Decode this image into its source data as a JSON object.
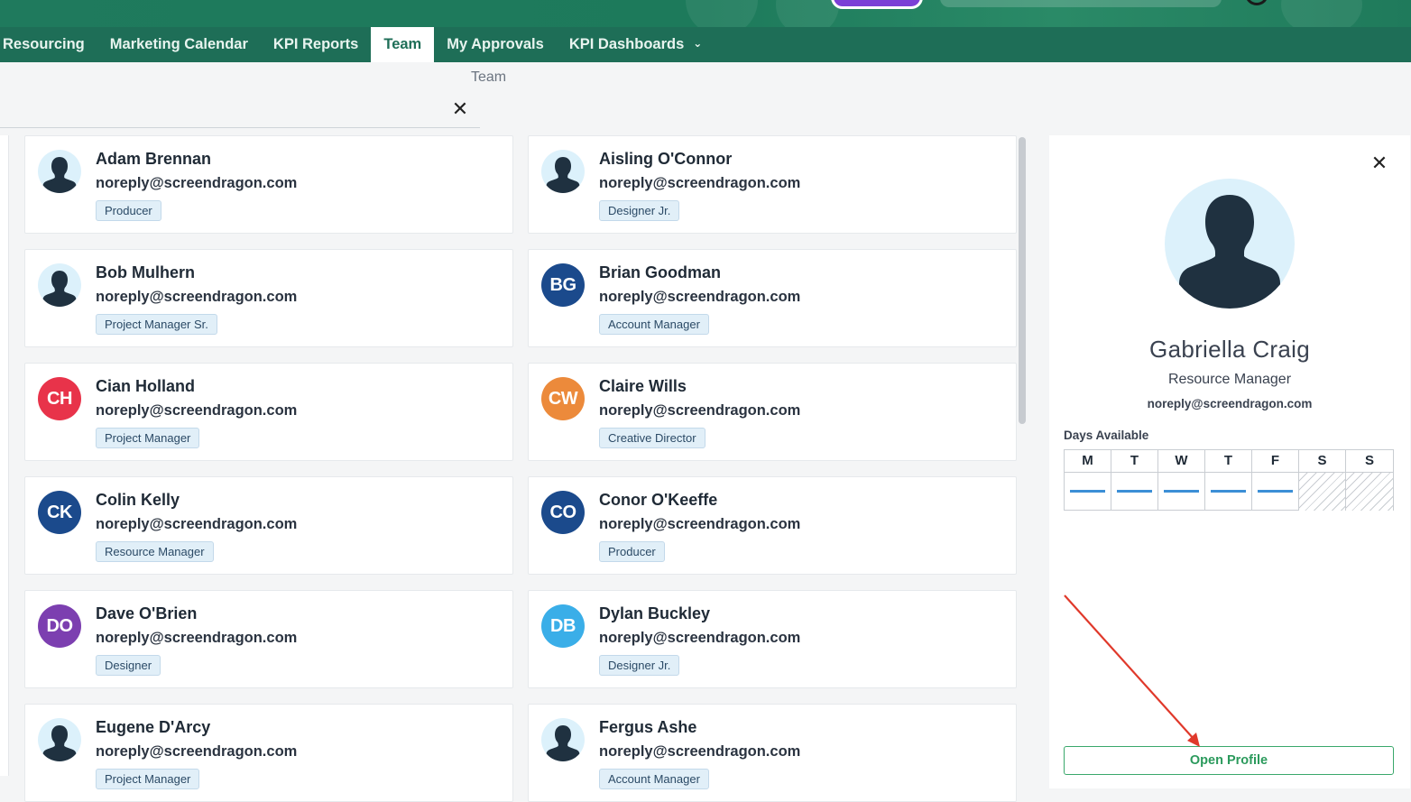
{
  "nav": {
    "items": [
      {
        "label": "Resourcing"
      },
      {
        "label": "Marketing Calendar"
      },
      {
        "label": "KPI Reports"
      },
      {
        "label": "Team"
      },
      {
        "label": "My Approvals"
      },
      {
        "label": "KPI Dashboards"
      }
    ],
    "active": "Team"
  },
  "breadcrumb": "Team",
  "members": [
    {
      "name": "Adam Brennan",
      "email": "noreply@screendragon.com",
      "role": "Producer",
      "avatar": "photo"
    },
    {
      "name": "Aisling O'Connor",
      "email": "noreply@screendragon.com",
      "role": "Designer Jr.",
      "avatar": "photo"
    },
    {
      "name": "Bob Mulhern",
      "email": "noreply@screendragon.com",
      "role": "Project Manager Sr.",
      "avatar": "photo"
    },
    {
      "name": "Brian Goodman",
      "email": "noreply@screendragon.com",
      "role": "Account Manager",
      "avatar": "BG",
      "color": "#1b4a8c"
    },
    {
      "name": "Cian Holland",
      "email": "noreply@screendragon.com",
      "role": "Project Manager",
      "avatar": "CH",
      "color": "#e8334a"
    },
    {
      "name": "Claire Wills",
      "email": "noreply@screendragon.com",
      "role": "Creative Director",
      "avatar": "CW",
      "color": "#ec8a3b"
    },
    {
      "name": "Colin Kelly",
      "email": "noreply@screendragon.com",
      "role": "Resource Manager",
      "avatar": "CK",
      "color": "#1b4a8c"
    },
    {
      "name": "Conor O'Keeffe",
      "email": "noreply@screendragon.com",
      "role": "Producer",
      "avatar": "CO",
      "color": "#1b4a8c"
    },
    {
      "name": "Dave O'Brien",
      "email": "noreply@screendragon.com",
      "role": "Designer",
      "avatar": "DO",
      "color": "#7c3fb0"
    },
    {
      "name": "Dylan Buckley",
      "email": "noreply@screendragon.com",
      "role": "Designer Jr.",
      "avatar": "DB",
      "color": "#3aaee8"
    },
    {
      "name": "Eugene D'Arcy",
      "email": "noreply@screendragon.com",
      "role": "Project Manager",
      "avatar": "photo"
    },
    {
      "name": "Fergus Ashe",
      "email": "noreply@screendragon.com",
      "role": "Account Manager",
      "avatar": "photo"
    }
  ],
  "profile": {
    "name": "Gabriella Craig",
    "role": "Resource Manager",
    "email": "noreply@screendragon.com",
    "days_label": "Days Available",
    "days": [
      {
        "day": "M",
        "available": true
      },
      {
        "day": "T",
        "available": true
      },
      {
        "day": "W",
        "available": true
      },
      {
        "day": "T",
        "available": true
      },
      {
        "day": "F",
        "available": true
      },
      {
        "day": "S",
        "available": false
      },
      {
        "day": "S",
        "available": false
      }
    ],
    "open_label": "Open Profile"
  },
  "colors": {
    "nav_bg": "#1e6e57",
    "accent_green": "#2b9a5c",
    "annotation_arrow": "#e0392b"
  },
  "icons": {
    "clear": "close-icon",
    "panel_close": "close-icon",
    "dropdown": "chevron-down-icon",
    "avatar_placeholder": "person-silhouette-icon"
  }
}
